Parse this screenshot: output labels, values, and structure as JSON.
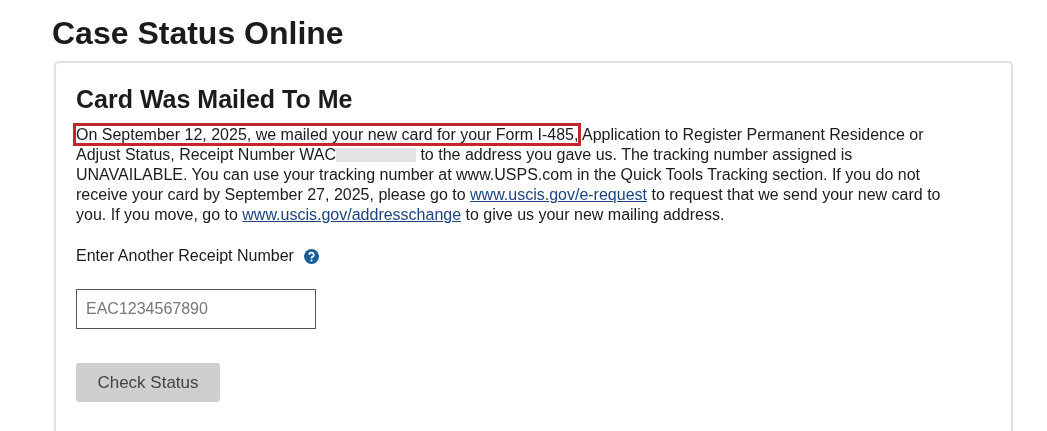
{
  "page_title": "Case Status Online",
  "card": {
    "title": "Card Was Mailed To Me",
    "paragraph": [
      {
        "kind": "highlight",
        "text": "On September 12, 2025, we mailed your new card for your Form I-485,"
      },
      {
        "kind": "text",
        "text": " Application to Register Permanent Residence or Adjust Status, Receipt Number WAC"
      },
      {
        "kind": "redacted"
      },
      {
        "kind": "text",
        "text": " to the address you gave us. The tracking number assigned is UNAVAILABLE. You can use your tracking number at www.USPS.com in the Quick Tools Tracking section. If you do not receive your card by September 27, 2025, please go to "
      },
      {
        "kind": "link",
        "text": "www.uscis.gov/e-request"
      },
      {
        "kind": "text",
        "text": " to request that we send your new card to you. If you move, go to "
      },
      {
        "kind": "link",
        "text": "www.uscis.gov/addresschange"
      },
      {
        "kind": "text",
        "text": " to give us your new mailing address."
      }
    ],
    "receipt_label": "Enter Another Receipt Number",
    "receipt_field": {
      "placeholder": "EAC1234567890"
    },
    "button": {
      "label": "Check Status",
      "disabled": true
    }
  }
}
